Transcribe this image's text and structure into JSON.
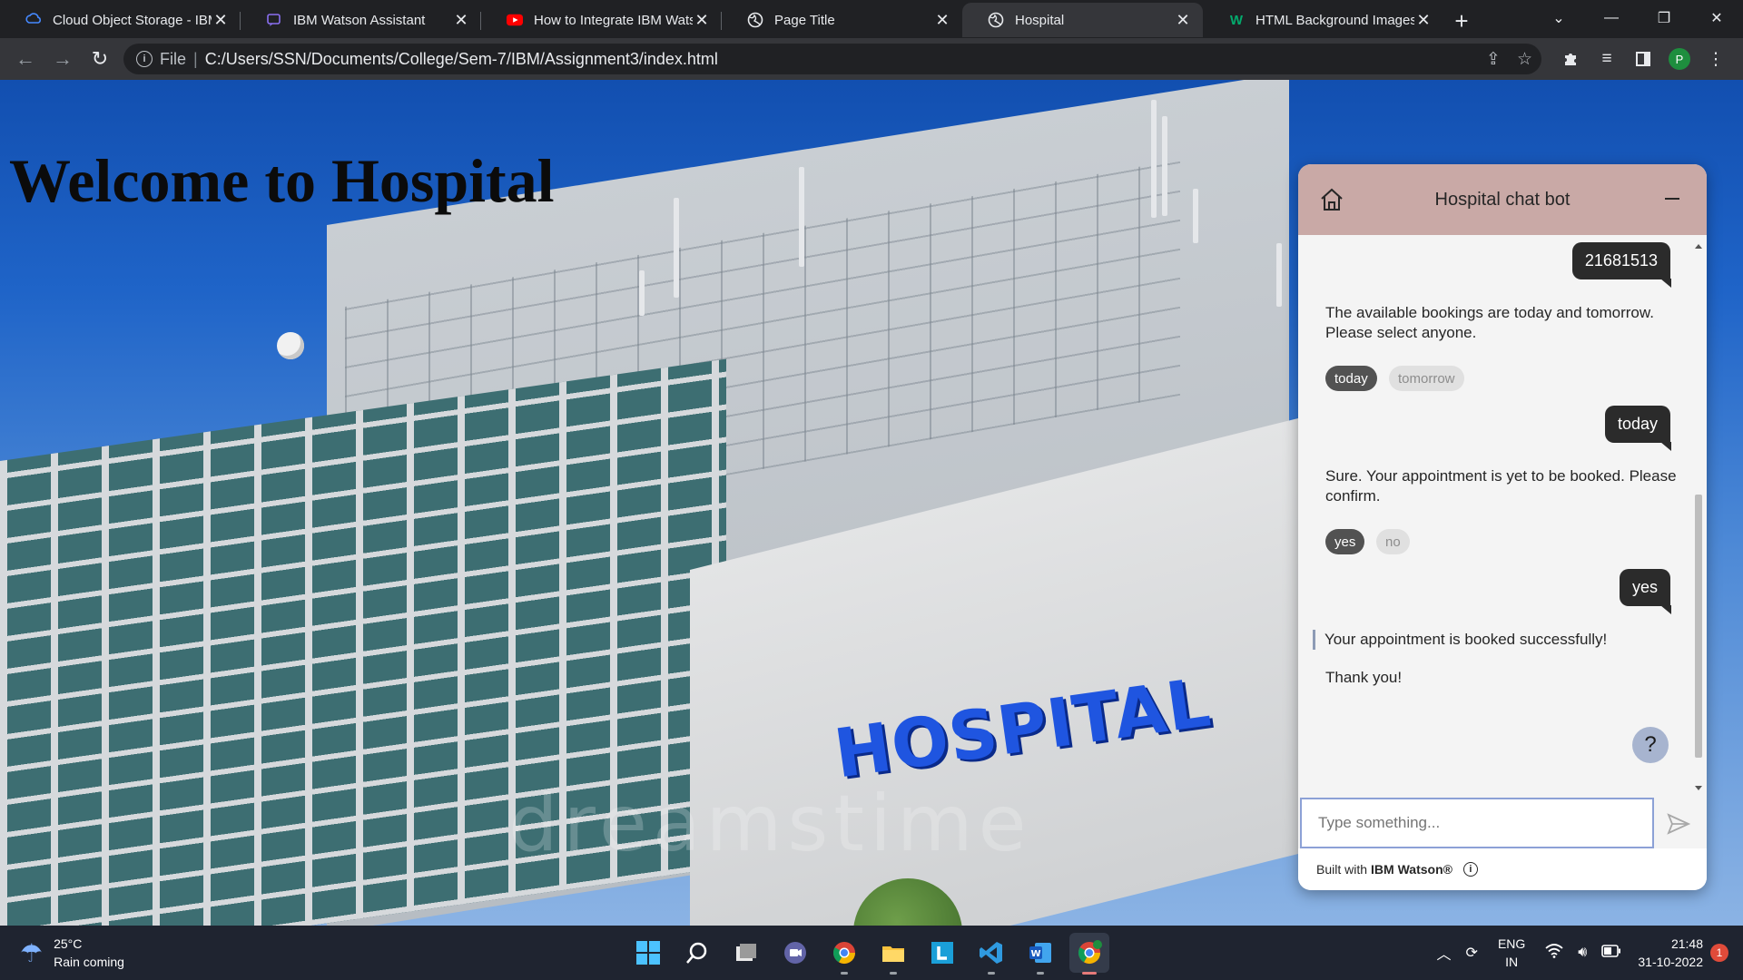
{
  "browser": {
    "tabs": [
      {
        "title": "Cloud Object Storage - IBM",
        "icon": "ibm-cloud-icon"
      },
      {
        "title": "IBM Watson Assistant",
        "icon": "watson-icon"
      },
      {
        "title": "How to Integrate IBM Watso",
        "icon": "youtube-icon"
      },
      {
        "title": "Page Title",
        "icon": "globe-icon"
      },
      {
        "title": "Hospital",
        "icon": "globe-icon",
        "active": true
      },
      {
        "title": "HTML Background Images",
        "icon": "w3schools-icon"
      }
    ],
    "address": {
      "scheme": "File",
      "path": "C:/Users/SSN/Documents/College/Sem-7/IBM/Assignment3/index.html"
    },
    "profile_initial": "P"
  },
  "page": {
    "heading": "Welcome to Hospital",
    "sign_text": "HOSPITAL",
    "watermark": "dreamstime"
  },
  "chat": {
    "title": "Hospital chat bot",
    "messages": {
      "user_1": "21681513",
      "bot_1": "The available bookings are today and tomorrow. Please select anyone.",
      "opt_1a": "today",
      "opt_1b": "tomorrow",
      "user_2": "today",
      "bot_2": "Sure. Your appointment is yet to be booked. Please confirm.",
      "opt_2a": "yes",
      "opt_2b": "no",
      "user_3": "yes",
      "bot_3": "Your appointment is booked successfully!",
      "bot_4": "Thank you!"
    },
    "input_placeholder": "Type something...",
    "footer_prefix": "Built with",
    "footer_brand": "IBM Watson®",
    "help_label": "?"
  },
  "taskbar": {
    "weather_temp": "25°C",
    "weather_desc": "Rain coming",
    "lang_top": "ENG",
    "lang_bottom": "IN",
    "time": "21:48",
    "date": "31-10-2022",
    "notifications": "1"
  },
  "colors": {
    "chat_header": "#c9a9a6",
    "sign_blue": "#1f55e0",
    "user_bubble": "#2b2b2b"
  }
}
